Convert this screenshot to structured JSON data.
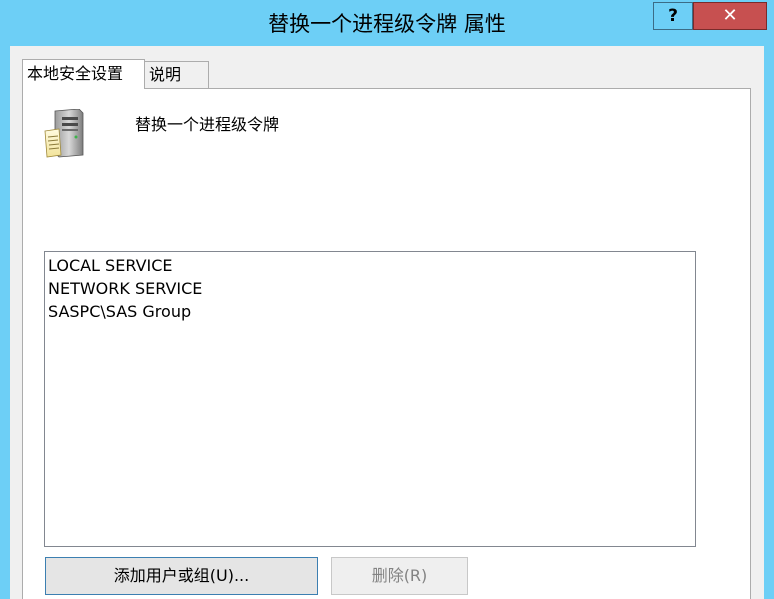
{
  "window": {
    "title": "替换一个进程级令牌 属性",
    "help_label": "?",
    "close_label": "✕"
  },
  "tabs": [
    {
      "label": "本地安全设置",
      "active": true
    },
    {
      "label": "说明",
      "active": false
    }
  ],
  "policy": {
    "icon": "server-policy-icon",
    "name": "替换一个进程级令牌"
  },
  "accounts": [
    "LOCAL SERVICE",
    "NETWORK SERVICE",
    "SASPC\\SAS Group"
  ],
  "buttons": {
    "add_label": "添加用户或组(U)...",
    "remove_label": "删除(R)"
  },
  "colors": {
    "titlebar": "#6dcff6",
    "close_button": "#c75050"
  }
}
